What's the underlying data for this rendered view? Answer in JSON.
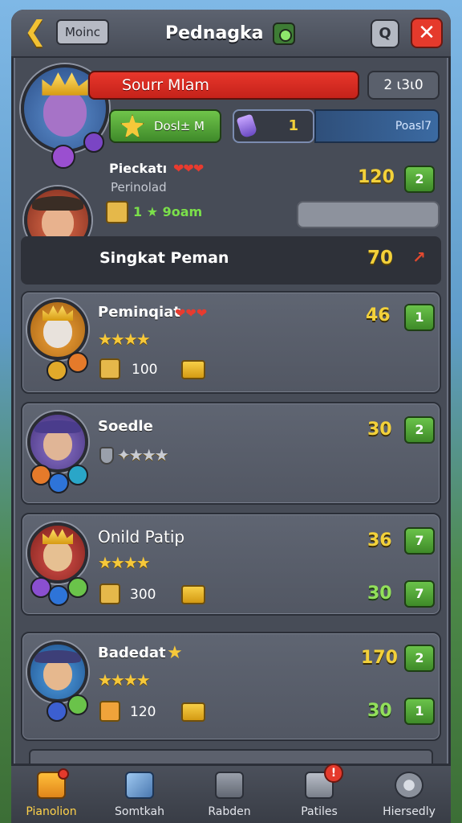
{
  "header": {
    "mode_label": "Moinc",
    "title": "Pednagka",
    "search_label": "Q",
    "close_label": "✕",
    "back_label": "❮"
  },
  "hero": {
    "name": "Sourr Mlam",
    "score": "2 ι3ι0",
    "boost_label": "Dosl± M",
    "potion_value": "1",
    "power_label": "Poasl7"
  },
  "featured": {
    "name": "Pieckatı",
    "subtitle": "Perinolad",
    "hearts": "❤❤❤",
    "item_text": "1 ★ 9oam",
    "score": "120",
    "rank": "2",
    "highlight_label": "Singkat Peman",
    "highlight_score": "70",
    "highlight_arrow": "↗"
  },
  "cards": [
    {
      "name": "Peminqiat",
      "hearts": "❤❤❤",
      "stars_full": "★★★★",
      "stars_empty": "",
      "item_value": "100",
      "score": "46",
      "rank": "1"
    },
    {
      "name": "Soedle",
      "hearts": "",
      "stars_full": "",
      "stars_empty": "✦★★★",
      "item_value": "",
      "score": "30",
      "rank": "2"
    },
    {
      "name": "Onild Patip",
      "hearts": "",
      "stars_full": "★★★★",
      "stars_empty": "",
      "item_value": "300",
      "score": "36",
      "rank": "7",
      "score2": "30",
      "rank2": "7"
    },
    {
      "name": "Badedat",
      "hearts": "★",
      "stars_full": "★★★★",
      "stars_empty": "",
      "item_value": "120",
      "score": "170",
      "rank": "2",
      "score2": "30",
      "rank2": "1"
    }
  ],
  "nav": [
    {
      "label": "Pianolion",
      "icon": "cheese-icon",
      "active": true
    },
    {
      "label": "Somtkah",
      "icon": "sword-icon",
      "active": false
    },
    {
      "label": "Rabden",
      "icon": "backpack-icon",
      "active": false
    },
    {
      "label": "Patiles",
      "icon": "crate-icon",
      "active": false,
      "badge": "!"
    },
    {
      "label": "Hiersedly",
      "icon": "gear-icon",
      "active": false
    }
  ],
  "colors": {
    "accent_gold": "#f3d13a",
    "accent_green": "#6ac34a",
    "accent_red": "#e53a2c",
    "panel": "#474c57"
  }
}
